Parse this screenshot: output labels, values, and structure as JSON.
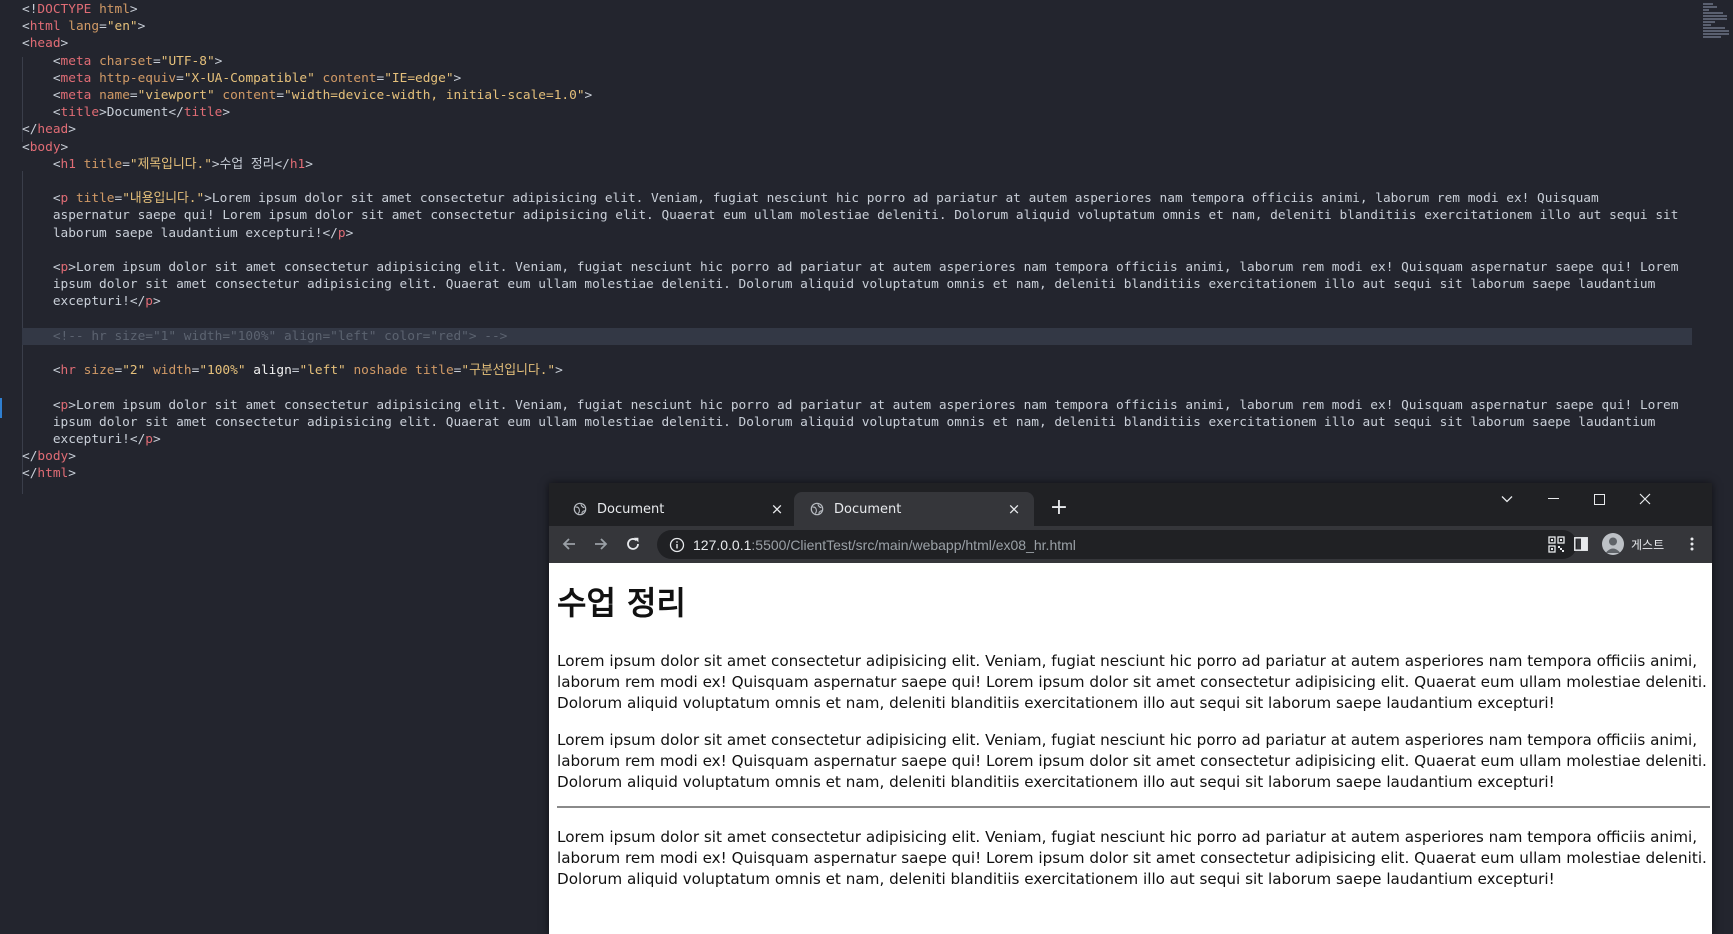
{
  "editor": {
    "lines": [
      [
        [
          "p",
          "<!"
        ],
        [
          "t",
          "DOCTYPE"
        ],
        [
          "p",
          " "
        ],
        [
          "a",
          "html"
        ],
        [
          "p",
          ">"
        ]
      ],
      [
        [
          "p",
          "<"
        ],
        [
          "t",
          "html"
        ],
        [
          "p",
          " "
        ],
        [
          "a",
          "lang"
        ],
        [
          "p",
          "="
        ],
        [
          "s",
          "\"en\""
        ],
        [
          "p",
          ">"
        ]
      ],
      [
        [
          "p",
          "<"
        ],
        [
          "t",
          "head"
        ],
        [
          "p",
          ">"
        ]
      ],
      [
        [
          "p",
          "    <"
        ],
        [
          "t",
          "meta"
        ],
        [
          "p",
          " "
        ],
        [
          "a",
          "charset"
        ],
        [
          "p",
          "="
        ],
        [
          "s",
          "\"UTF-8\""
        ],
        [
          "p",
          ">"
        ]
      ],
      [
        [
          "p",
          "    <"
        ],
        [
          "t",
          "meta"
        ],
        [
          "p",
          " "
        ],
        [
          "a",
          "http-equiv"
        ],
        [
          "p",
          "="
        ],
        [
          "s",
          "\"X-UA-Compatible\""
        ],
        [
          "p",
          " "
        ],
        [
          "a",
          "content"
        ],
        [
          "p",
          "="
        ],
        [
          "s",
          "\"IE=edge\""
        ],
        [
          "p",
          ">"
        ]
      ],
      [
        [
          "p",
          "    <"
        ],
        [
          "t",
          "meta"
        ],
        [
          "p",
          " "
        ],
        [
          "a",
          "name"
        ],
        [
          "p",
          "="
        ],
        [
          "s",
          "\"viewport\""
        ],
        [
          "p",
          " "
        ],
        [
          "a",
          "content"
        ],
        [
          "p",
          "="
        ],
        [
          "s",
          "\"width=device-width, initial-scale=1.0\""
        ],
        [
          "p",
          ">"
        ]
      ],
      [
        [
          "p",
          "    <"
        ],
        [
          "t",
          "title"
        ],
        [
          "p",
          ">Document</"
        ],
        [
          "t",
          "title"
        ],
        [
          "p",
          ">"
        ]
      ],
      [
        [
          "p",
          "</"
        ],
        [
          "t",
          "head"
        ],
        [
          "p",
          ">"
        ]
      ],
      [
        [
          "p",
          "<"
        ],
        [
          "t",
          "body"
        ],
        [
          "p",
          ">"
        ]
      ],
      [
        [
          "p",
          "    <"
        ],
        [
          "t",
          "h1"
        ],
        [
          "p",
          " "
        ],
        [
          "a",
          "title"
        ],
        [
          "p",
          "="
        ],
        [
          "s",
          "\"제목입니다.\""
        ],
        [
          "p",
          ">수업 정리</"
        ],
        [
          "t",
          "h1"
        ],
        [
          "p",
          ">"
        ]
      ],
      [],
      [
        [
          "p",
          "    <"
        ],
        [
          "t",
          "p"
        ],
        [
          "p",
          " "
        ],
        [
          "a",
          "title"
        ],
        [
          "p",
          "="
        ],
        [
          "s",
          "\"내용입니다.\""
        ],
        [
          "p",
          ">Lorem ipsum dolor sit amet consectetur adipisicing elit. Veniam, fugiat nesciunt hic porro ad pariatur at autem asperiores nam tempora officiis animi, laborum rem modi ex! Quisquam"
        ]
      ],
      [
        [
          "p",
          "    aspernatur saepe qui! Lorem ipsum dolor sit amet consectetur adipisicing elit. Quaerat eum ullam molestiae deleniti. Dolorum aliquid voluptatum omnis et nam, deleniti blanditiis exercitationem illo aut sequi sit"
        ]
      ],
      [
        [
          "p",
          "    laborum saepe laudantium excepturi!</"
        ],
        [
          "t",
          "p"
        ],
        [
          "p",
          ">"
        ]
      ],
      [],
      [
        [
          "p",
          "    <"
        ],
        [
          "t",
          "p"
        ],
        [
          "p",
          ">Lorem ipsum dolor sit amet consectetur adipisicing elit. Veniam, fugiat nesciunt hic porro ad pariatur at autem asperiores nam tempora officiis animi, laborum rem modi ex! Quisquam aspernatur saepe qui! Lorem"
        ]
      ],
      [
        [
          "p",
          "    ipsum dolor sit amet consectetur adipisicing elit. Quaerat eum ullam molestiae deleniti. Dolorum aliquid voluptatum omnis et nam, deleniti blanditiis exercitationem illo aut sequi sit laborum saepe laudantium"
        ]
      ],
      [
        [
          "p",
          "    excepturi!</"
        ],
        [
          "t",
          "p"
        ],
        [
          "p",
          ">"
        ]
      ],
      [],
      [
        [
          "c",
          "    <!-- hr size=\"1\" width=\"100%\" align=\"left\" color=\"red\"> -->"
        ]
      ],
      [],
      [
        [
          "p",
          "    <"
        ],
        [
          "t",
          "hr"
        ],
        [
          "p",
          " "
        ],
        [
          "a",
          "size"
        ],
        [
          "p",
          "="
        ],
        [
          "s",
          "\"2\""
        ],
        [
          "p",
          " "
        ],
        [
          "a",
          "width"
        ],
        [
          "p",
          "="
        ],
        [
          "s",
          "\"100%\""
        ],
        [
          "p",
          " "
        ],
        [
          "w",
          "align"
        ],
        [
          "p",
          "="
        ],
        [
          "s",
          "\"left\""
        ],
        [
          "p",
          " "
        ],
        [
          "a",
          "noshade"
        ],
        [
          "p",
          " "
        ],
        [
          "a",
          "title"
        ],
        [
          "p",
          "="
        ],
        [
          "s",
          "\"구분선입니다.\""
        ],
        [
          "p",
          ">"
        ]
      ],
      [],
      [
        [
          "p",
          "    <"
        ],
        [
          "t",
          "p"
        ],
        [
          "p",
          ">Lorem ipsum dolor sit amet consectetur adipisicing elit. Veniam, fugiat nesciunt hic porro ad pariatur at autem asperiores nam tempora officiis animi, laborum rem modi ex! Quisquam aspernatur saepe qui! Lorem"
        ]
      ],
      [
        [
          "p",
          "    ipsum dolor sit amet consectetur adipisicing elit. Quaerat eum ullam molestiae deleniti. Dolorum aliquid voluptatum omnis et nam, deleniti blanditiis exercitationem illo aut sequi sit laborum saepe laudantium"
        ]
      ],
      [
        [
          "p",
          "    excepturi!</"
        ],
        [
          "t",
          "p"
        ],
        [
          "p",
          ">"
        ]
      ],
      [
        [
          "p",
          "</"
        ],
        [
          "t",
          "body"
        ],
        [
          "p",
          ">"
        ]
      ],
      [
        [
          "p",
          "</"
        ],
        [
          "t",
          "html"
        ],
        [
          "p",
          ">"
        ]
      ]
    ],
    "highlighted_line": 19,
    "syntax_colors": {
      "tag": "#e06c75",
      "attribute": "#d19a66",
      "string": "#e5c07b",
      "comment": "#5c6370",
      "text": "#c9cfd8"
    }
  },
  "browser": {
    "tabs": [
      {
        "title": "Document",
        "icon": "globe-icon",
        "active": false
      },
      {
        "title": "Document",
        "icon": "globe-icon",
        "active": true
      }
    ],
    "new_tab_label": "+",
    "close_label": "×",
    "window_controls": [
      "chevron-down-icon",
      "minimize-icon",
      "maximize-icon",
      "close-icon"
    ],
    "url": {
      "host": "127.0.0.1",
      "rest": ":5500/ClientTest/src/main/webapp/html/ex08_hr.html"
    },
    "profile_label": "게스트"
  },
  "page": {
    "heading": "수업 정리",
    "paragraphs": [
      "Lorem ipsum dolor sit amet consectetur adipisicing elit. Veniam, fugiat nesciunt hic porro ad pariatur at autem asperiores nam tempora officiis animi, laborum rem modi ex! Quisquam aspernatur saepe qui! Lorem ipsum dolor sit amet consectetur adipisicing elit. Quaerat eum ullam molestiae deleniti. Dolorum aliquid voluptatum omnis et nam, deleniti blanditiis exercitationem illo aut sequi sit laborum saepe laudantium excepturi!",
      "Lorem ipsum dolor sit amet consectetur adipisicing elit. Veniam, fugiat nesciunt hic porro ad pariatur at autem asperiores nam tempora officiis animi, laborum rem modi ex! Quisquam aspernatur saepe qui! Lorem ipsum dolor sit amet consectetur adipisicing elit. Quaerat eum ullam molestiae deleniti. Dolorum aliquid voluptatum omnis et nam, deleniti blanditiis exercitationem illo aut sequi sit laborum saepe laudantium excepturi!",
      "Lorem ipsum dolor sit amet consectetur adipisicing elit. Veniam, fugiat nesciunt hic porro ad pariatur at autem asperiores nam tempora officiis animi, laborum rem modi ex! Quisquam aspernatur saepe qui! Lorem ipsum dolor sit amet consectetur adipisicing elit. Quaerat eum ullam molestiae deleniti. Dolorum aliquid voluptatum omnis et nam, deleniti blanditiis exercitationem illo aut sequi sit laborum saepe laudantium excepturi!"
    ]
  }
}
